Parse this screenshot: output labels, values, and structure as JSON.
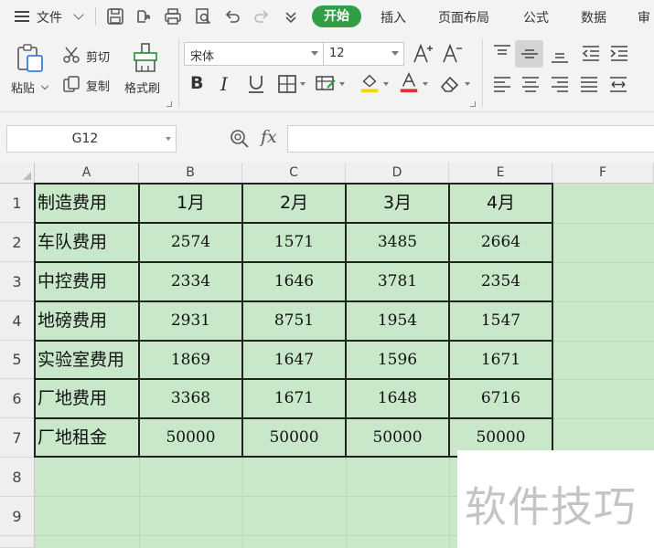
{
  "menubar": {
    "file_label": "文件",
    "tabs": [
      {
        "label": "开始",
        "active": true
      },
      {
        "label": "插入",
        "active": false
      },
      {
        "label": "页面布局",
        "active": false
      },
      {
        "label": "公式",
        "active": false
      },
      {
        "label": "数据",
        "active": false
      },
      {
        "label": "审",
        "active": false
      }
    ]
  },
  "ribbon": {
    "paste_label": "粘贴",
    "cut_label": "剪切",
    "copy_label": "复制",
    "format_painter_label": "格式刷",
    "font_name": "宋体",
    "font_size": "12"
  },
  "formula_bar": {
    "name_box": "G12",
    "fx_label": "fx",
    "formula_value": ""
  },
  "sheet": {
    "columns": [
      "A",
      "B",
      "C",
      "D",
      "E",
      "F"
    ],
    "rows": [
      "1",
      "2",
      "3",
      "4",
      "5",
      "6",
      "7",
      "8",
      "9"
    ],
    "header": [
      "制造费用",
      "1月",
      "2月",
      "3月",
      "4月"
    ],
    "data": [
      [
        "车队费用",
        "2574",
        "1571",
        "3485",
        "2664"
      ],
      [
        "中控费用",
        "2334",
        "1646",
        "3781",
        "2354"
      ],
      [
        "地磅费用",
        "2931",
        "8751",
        "1954",
        "1547"
      ],
      [
        "实验室费用",
        "1869",
        "1647",
        "1596",
        "1671"
      ],
      [
        "厂地费用",
        "3368",
        "1671",
        "1648",
        "6716"
      ],
      [
        "厂地租金",
        "50000",
        "50000",
        "50000",
        "50000"
      ]
    ]
  },
  "watermark": "软件技巧",
  "colors": {
    "accent": "#2f9e44",
    "sheet_fill": "#c8e8c9",
    "font_color_bar": "#e03030",
    "fill_color_bar": "#f5d400"
  }
}
